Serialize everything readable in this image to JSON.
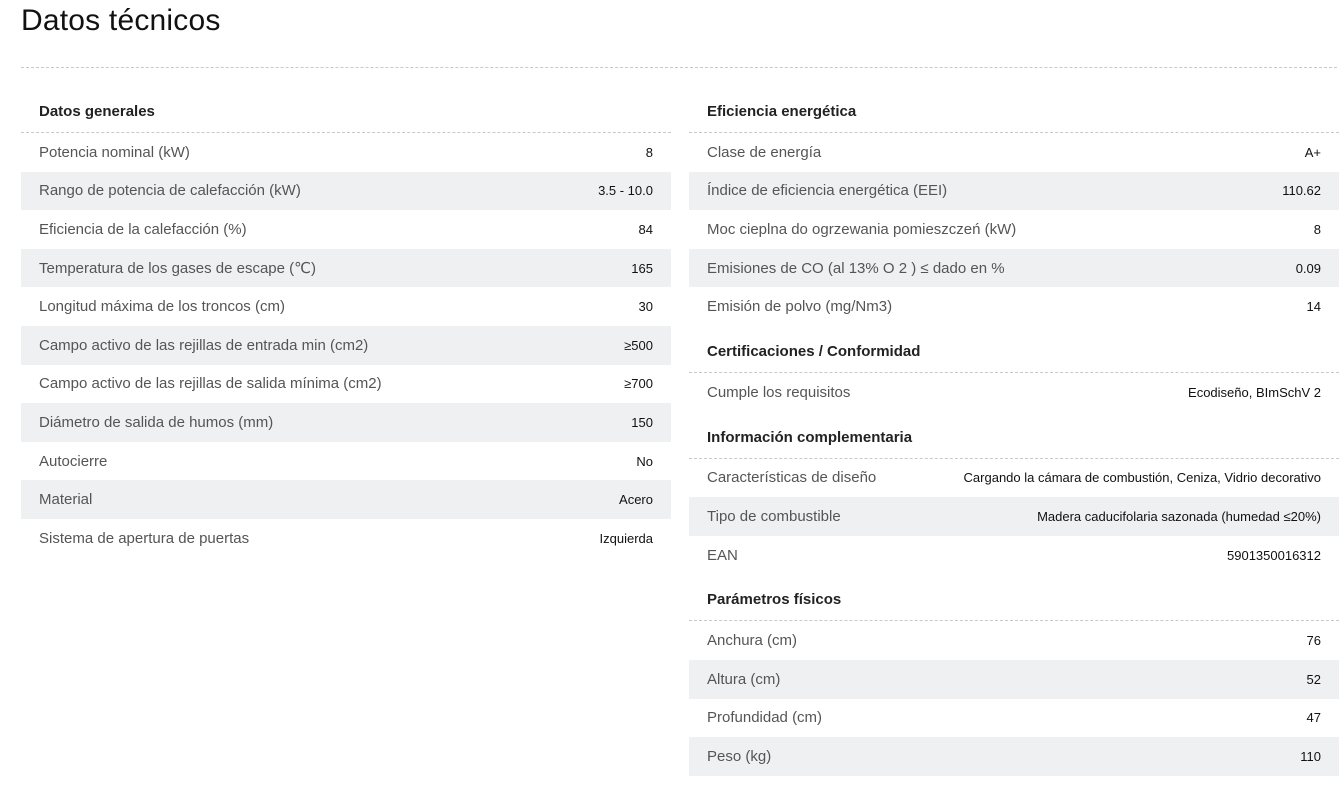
{
  "page": {
    "title": "Datos técnicos"
  },
  "left": {
    "sections": [
      {
        "title": "Datos generales",
        "rows": [
          {
            "label": "Potencia nominal (kW)",
            "value": "8"
          },
          {
            "label": "Rango de potencia de calefacción (kW)",
            "value": "3.5 - 10.0"
          },
          {
            "label": "Eficiencia de la calefacción (%)",
            "value": "84"
          },
          {
            "label": "Temperatura de los gases de escape (℃)",
            "value": "165"
          },
          {
            "label": "Longitud máxima de los troncos (cm)",
            "value": "30"
          },
          {
            "label": "Campo activo de las rejillas de entrada min (cm2)",
            "value": "≥500"
          },
          {
            "label": "Campo activo de las rejillas de salida mínima (cm2)",
            "value": "≥700"
          },
          {
            "label": "Diámetro de salida de humos (mm)",
            "value": "150"
          },
          {
            "label": "Autocierre",
            "value": "No"
          },
          {
            "label": "Material",
            "value": "Acero"
          },
          {
            "label": "Sistema de apertura de puertas",
            "value": "Izquierda"
          }
        ]
      }
    ]
  },
  "right": {
    "sections": [
      {
        "title": "Eficiencia energética",
        "rows": [
          {
            "label": "Clase de energía",
            "value": "A+"
          },
          {
            "label": "Índice de eficiencia energética (EEI)",
            "value": "110.62"
          },
          {
            "label": "Moc cieplna do ogrzewania pomieszczeń (kW)",
            "value": "8"
          },
          {
            "label": "Emisiones de CO (al 13% O 2 ) ≤ dado en %",
            "value": "0.09"
          },
          {
            "label": "Emisión de polvo (mg/Nm3)",
            "value": "14"
          }
        ]
      },
      {
        "title": "Certificaciones / Conformidad",
        "rows": [
          {
            "label": "Cumple los requisitos",
            "value": "Ecodiseño, BImSchV 2"
          }
        ]
      },
      {
        "title": "Información complementaria",
        "rows": [
          {
            "label": "Características de diseño",
            "value": "Cargando la cámara de combustión, Ceniza, Vidrio decorativo"
          },
          {
            "label": "Tipo de combustible",
            "value": "Madera caducifolaria sazonada (humedad ≤20%)"
          },
          {
            "label": "EAN",
            "value": "5901350016312"
          }
        ]
      },
      {
        "title": "Parámetros físicos",
        "rows": [
          {
            "label": "Anchura (cm)",
            "value": "76"
          },
          {
            "label": "Altura (cm)",
            "value": "52"
          },
          {
            "label": "Profundidad (cm)",
            "value": "47"
          },
          {
            "label": "Peso (kg)",
            "value": "110"
          }
        ]
      }
    ]
  },
  "colors": {
    "row_alt": "#eff0f2",
    "divider": "#c9c9c9"
  }
}
